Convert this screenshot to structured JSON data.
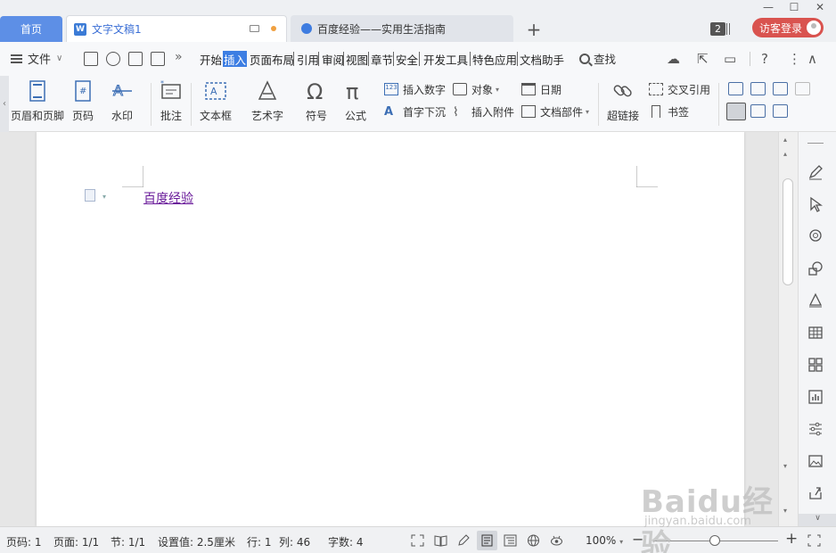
{
  "tabs": {
    "home": "首页",
    "doc": "文字文稿1",
    "web": "百度经验——实用生活指南",
    "count": "2",
    "login": "访客登录"
  },
  "menu": {
    "file": "文件",
    "items": [
      "开始",
      "插入",
      "页面布局",
      "引用",
      "审阅",
      "视图",
      "章节",
      "安全",
      "开发工具",
      "特色应用",
      "文档助手"
    ],
    "active": "插入",
    "search": "查找"
  },
  "ribbon": {
    "header_footer": "页眉和页脚",
    "page_num": "页码",
    "watermark": "水印",
    "comment": "批注",
    "textbox": "文本框",
    "wordart": "艺术字",
    "symbol": "符号",
    "formula": "公式",
    "insert_number": "插入数字",
    "object": "对象",
    "date": "日期",
    "drop_cap": "首字下沉",
    "attachment": "插入附件",
    "doc_parts": "文档部件",
    "hyperlink": "超链接",
    "cross_ref": "交叉引用",
    "bookmark": "书签"
  },
  "document": {
    "text": "百度经验"
  },
  "status": {
    "page_num": "页码: 1",
    "pages": "页面: 1/1",
    "section": "节: 1/1",
    "setting": "设置值: 2.5厘米",
    "row": "行: 1",
    "col": "列: 46",
    "words": "字数: 4",
    "zoom": "100%"
  },
  "watermark": {
    "brand": "Baidu经验",
    "url": "jingyan.baidu.com"
  },
  "colors": {
    "accent": "#3d7ee3",
    "home_tab": "#5d8fe6",
    "login": "#d9534f",
    "doc_text": "#6a1b9a"
  }
}
